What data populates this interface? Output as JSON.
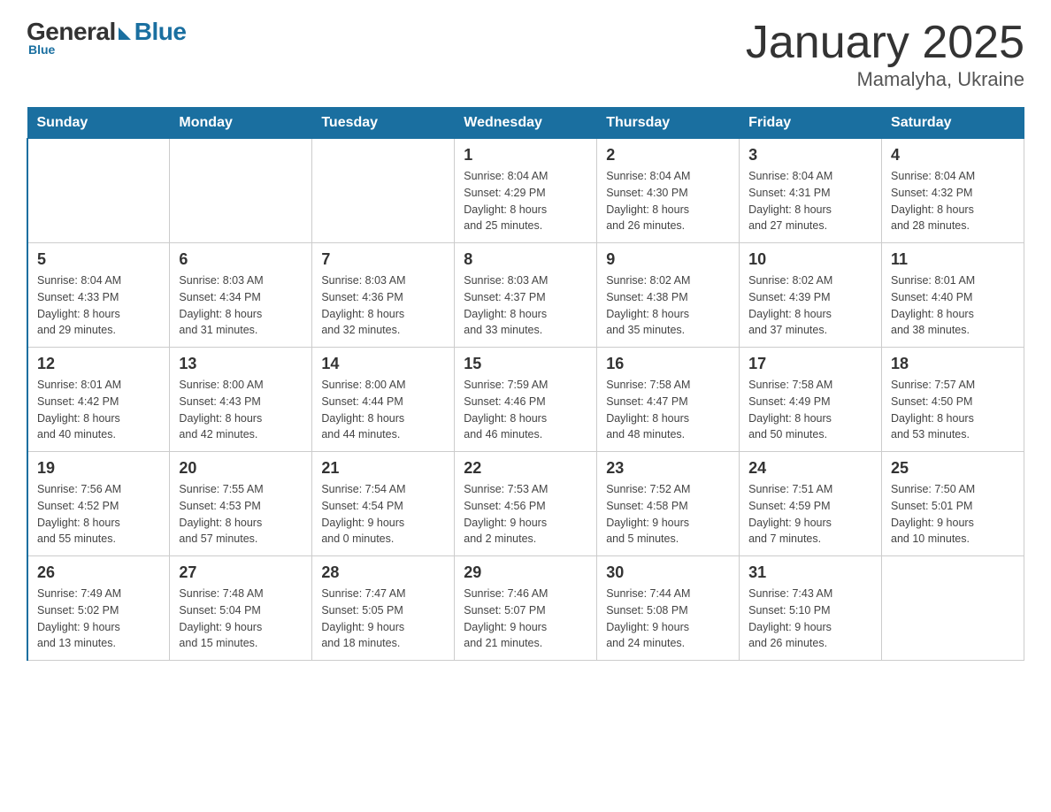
{
  "logo": {
    "general": "General",
    "blue": "Blue",
    "tagline": "Blue"
  },
  "title": "January 2025",
  "subtitle": "Mamalyha, Ukraine",
  "headers": [
    "Sunday",
    "Monday",
    "Tuesday",
    "Wednesday",
    "Thursday",
    "Friday",
    "Saturday"
  ],
  "weeks": [
    [
      {
        "day": "",
        "info": ""
      },
      {
        "day": "",
        "info": ""
      },
      {
        "day": "",
        "info": ""
      },
      {
        "day": "1",
        "info": "Sunrise: 8:04 AM\nSunset: 4:29 PM\nDaylight: 8 hours\nand 25 minutes."
      },
      {
        "day": "2",
        "info": "Sunrise: 8:04 AM\nSunset: 4:30 PM\nDaylight: 8 hours\nand 26 minutes."
      },
      {
        "day": "3",
        "info": "Sunrise: 8:04 AM\nSunset: 4:31 PM\nDaylight: 8 hours\nand 27 minutes."
      },
      {
        "day": "4",
        "info": "Sunrise: 8:04 AM\nSunset: 4:32 PM\nDaylight: 8 hours\nand 28 minutes."
      }
    ],
    [
      {
        "day": "5",
        "info": "Sunrise: 8:04 AM\nSunset: 4:33 PM\nDaylight: 8 hours\nand 29 minutes."
      },
      {
        "day": "6",
        "info": "Sunrise: 8:03 AM\nSunset: 4:34 PM\nDaylight: 8 hours\nand 31 minutes."
      },
      {
        "day": "7",
        "info": "Sunrise: 8:03 AM\nSunset: 4:36 PM\nDaylight: 8 hours\nand 32 minutes."
      },
      {
        "day": "8",
        "info": "Sunrise: 8:03 AM\nSunset: 4:37 PM\nDaylight: 8 hours\nand 33 minutes."
      },
      {
        "day": "9",
        "info": "Sunrise: 8:02 AM\nSunset: 4:38 PM\nDaylight: 8 hours\nand 35 minutes."
      },
      {
        "day": "10",
        "info": "Sunrise: 8:02 AM\nSunset: 4:39 PM\nDaylight: 8 hours\nand 37 minutes."
      },
      {
        "day": "11",
        "info": "Sunrise: 8:01 AM\nSunset: 4:40 PM\nDaylight: 8 hours\nand 38 minutes."
      }
    ],
    [
      {
        "day": "12",
        "info": "Sunrise: 8:01 AM\nSunset: 4:42 PM\nDaylight: 8 hours\nand 40 minutes."
      },
      {
        "day": "13",
        "info": "Sunrise: 8:00 AM\nSunset: 4:43 PM\nDaylight: 8 hours\nand 42 minutes."
      },
      {
        "day": "14",
        "info": "Sunrise: 8:00 AM\nSunset: 4:44 PM\nDaylight: 8 hours\nand 44 minutes."
      },
      {
        "day": "15",
        "info": "Sunrise: 7:59 AM\nSunset: 4:46 PM\nDaylight: 8 hours\nand 46 minutes."
      },
      {
        "day": "16",
        "info": "Sunrise: 7:58 AM\nSunset: 4:47 PM\nDaylight: 8 hours\nand 48 minutes."
      },
      {
        "day": "17",
        "info": "Sunrise: 7:58 AM\nSunset: 4:49 PM\nDaylight: 8 hours\nand 50 minutes."
      },
      {
        "day": "18",
        "info": "Sunrise: 7:57 AM\nSunset: 4:50 PM\nDaylight: 8 hours\nand 53 minutes."
      }
    ],
    [
      {
        "day": "19",
        "info": "Sunrise: 7:56 AM\nSunset: 4:52 PM\nDaylight: 8 hours\nand 55 minutes."
      },
      {
        "day": "20",
        "info": "Sunrise: 7:55 AM\nSunset: 4:53 PM\nDaylight: 8 hours\nand 57 minutes."
      },
      {
        "day": "21",
        "info": "Sunrise: 7:54 AM\nSunset: 4:54 PM\nDaylight: 9 hours\nand 0 minutes."
      },
      {
        "day": "22",
        "info": "Sunrise: 7:53 AM\nSunset: 4:56 PM\nDaylight: 9 hours\nand 2 minutes."
      },
      {
        "day": "23",
        "info": "Sunrise: 7:52 AM\nSunset: 4:58 PM\nDaylight: 9 hours\nand 5 minutes."
      },
      {
        "day": "24",
        "info": "Sunrise: 7:51 AM\nSunset: 4:59 PM\nDaylight: 9 hours\nand 7 minutes."
      },
      {
        "day": "25",
        "info": "Sunrise: 7:50 AM\nSunset: 5:01 PM\nDaylight: 9 hours\nand 10 minutes."
      }
    ],
    [
      {
        "day": "26",
        "info": "Sunrise: 7:49 AM\nSunset: 5:02 PM\nDaylight: 9 hours\nand 13 minutes."
      },
      {
        "day": "27",
        "info": "Sunrise: 7:48 AM\nSunset: 5:04 PM\nDaylight: 9 hours\nand 15 minutes."
      },
      {
        "day": "28",
        "info": "Sunrise: 7:47 AM\nSunset: 5:05 PM\nDaylight: 9 hours\nand 18 minutes."
      },
      {
        "day": "29",
        "info": "Sunrise: 7:46 AM\nSunset: 5:07 PM\nDaylight: 9 hours\nand 21 minutes."
      },
      {
        "day": "30",
        "info": "Sunrise: 7:44 AM\nSunset: 5:08 PM\nDaylight: 9 hours\nand 24 minutes."
      },
      {
        "day": "31",
        "info": "Sunrise: 7:43 AM\nSunset: 5:10 PM\nDaylight: 9 hours\nand 26 minutes."
      },
      {
        "day": "",
        "info": ""
      }
    ]
  ]
}
